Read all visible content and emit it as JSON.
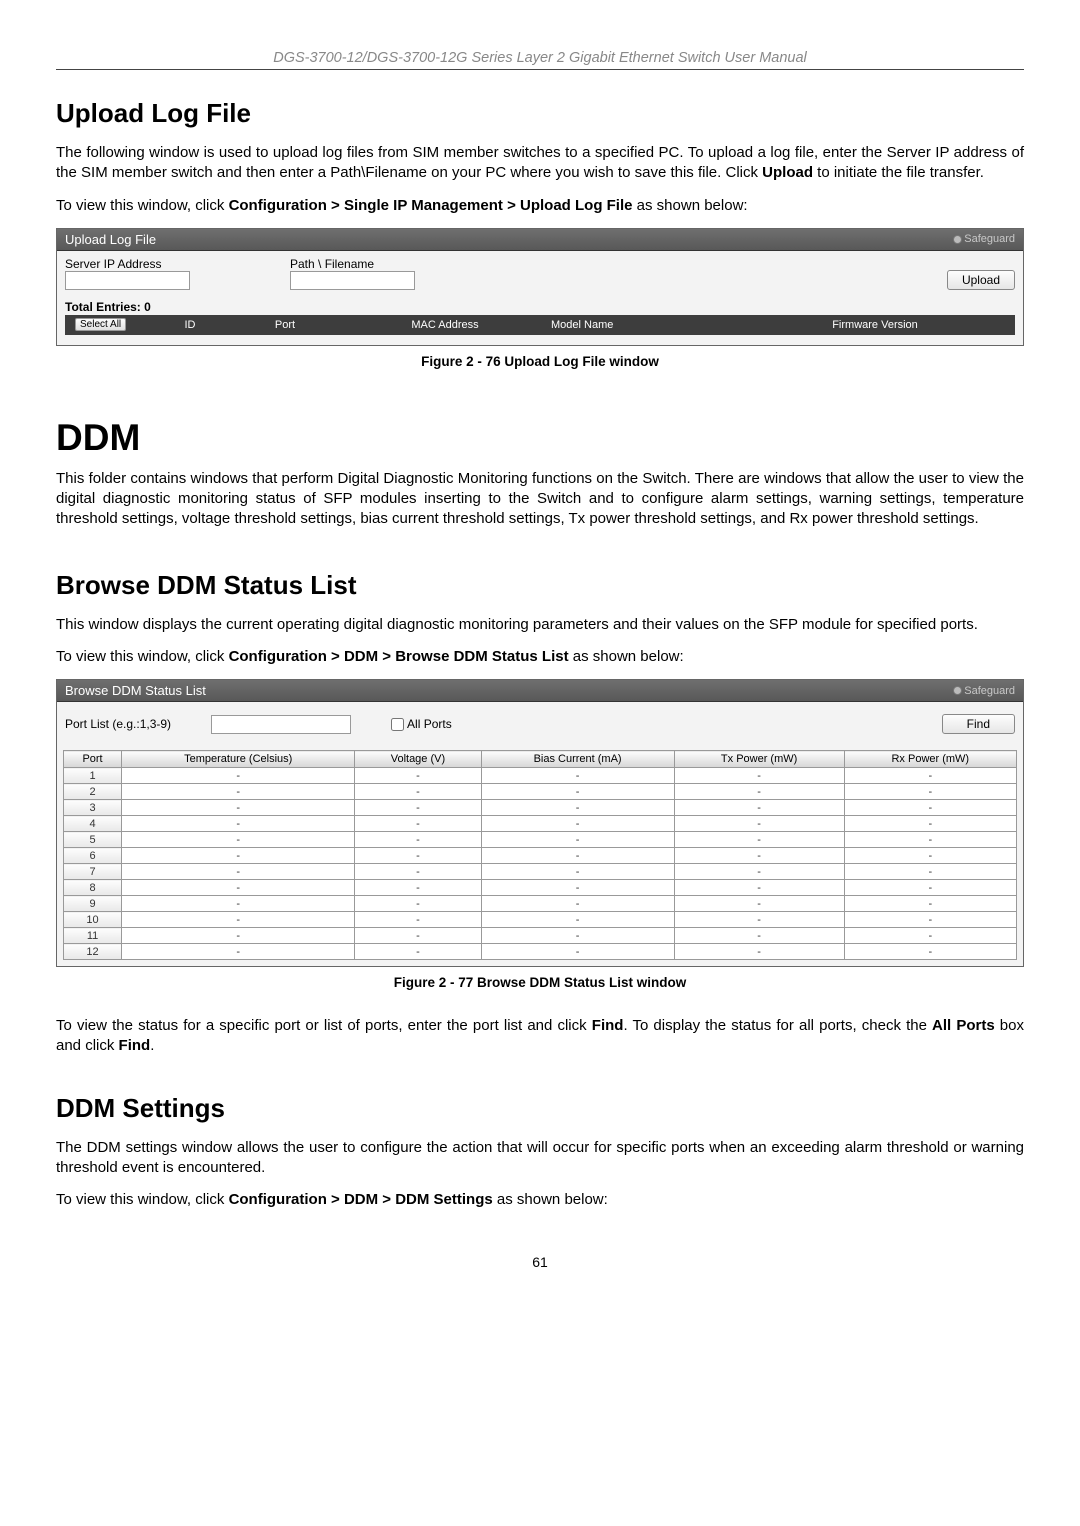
{
  "header_text": "DGS-3700-12/DGS-3700-12G Series Layer 2 Gigabit Ethernet Switch User Manual",
  "page_number": "61",
  "section_upload": {
    "title": "Upload Log File",
    "para1_pre": "The following window is used to upload log files from SIM member switches to a specified PC. To upload a log file, enter the Server IP address of the SIM member switch and then enter a Path\\Filename on your PC where you wish to save this file. Click ",
    "para1_bold": "Upload",
    "para1_post": " to initiate the file transfer.",
    "nav_pre": "To view this window, click ",
    "nav_bold": "Configuration > Single IP Management > Upload Log File",
    "nav_post": " as shown below:"
  },
  "fig_upload": {
    "panel_title": "Upload Log File",
    "safeguard": "Safeguard",
    "server_ip_label": "Server IP Address",
    "path_label": "Path \\ Filename",
    "upload_btn": "Upload",
    "total_entries": "Total Entries: 0",
    "select_all": "Select All",
    "cols": {
      "id": "ID",
      "port": "Port",
      "mac": "MAC Address",
      "model": "Model Name",
      "fw": "Firmware Version"
    },
    "caption": "Figure 2 - 76 Upload Log File window"
  },
  "section_ddm": {
    "title": "DDM",
    "para": "This folder contains windows that perform Digital Diagnostic Monitoring functions on the Switch. There are windows that allow the user to view the digital diagnostic monitoring status of SFP modules inserting to the Switch and to configure alarm settings, warning settings, temperature threshold settings, voltage threshold settings, bias current threshold settings, Tx power threshold settings, and Rx power threshold settings."
  },
  "section_browse": {
    "title": "Browse DDM Status List",
    "para": "This window displays the current operating digital diagnostic monitoring parameters and their values on the SFP module for specified ports.",
    "nav_pre": "To view this window, click ",
    "nav_bold": "Configuration > DDM > Browse DDM Status List",
    "nav_post": " as shown below:"
  },
  "fig_browse": {
    "panel_title": "Browse DDM Status List",
    "safeguard": "Safeguard",
    "portlist_label": "Port List (e.g.:1,3-9)",
    "allports_label": "All Ports",
    "find_btn": "Find",
    "headers": [
      "Port",
      "Temperature (Celsius)",
      "Voltage (V)",
      "Bias Current (mA)",
      "Tx Power (mW)",
      "Rx Power (mW)"
    ],
    "caption": "Figure 2 - 77 Browse DDM Status List window"
  },
  "chart_data": {
    "type": "table",
    "headers": [
      "Port",
      "Temperature (Celsius)",
      "Voltage (V)",
      "Bias Current (mA)",
      "Tx Power (mW)",
      "Rx Power (mW)"
    ],
    "rows": [
      [
        "1",
        "-",
        "-",
        "-",
        "-",
        "-"
      ],
      [
        "2",
        "-",
        "-",
        "-",
        "-",
        "-"
      ],
      [
        "3",
        "-",
        "-",
        "-",
        "-",
        "-"
      ],
      [
        "4",
        "-",
        "-",
        "-",
        "-",
        "-"
      ],
      [
        "5",
        "-",
        "-",
        "-",
        "-",
        "-"
      ],
      [
        "6",
        "-",
        "-",
        "-",
        "-",
        "-"
      ],
      [
        "7",
        "-",
        "-",
        "-",
        "-",
        "-"
      ],
      [
        "8",
        "-",
        "-",
        "-",
        "-",
        "-"
      ],
      [
        "9",
        "-",
        "-",
        "-",
        "-",
        "-"
      ],
      [
        "10",
        "-",
        "-",
        "-",
        "-",
        "-"
      ],
      [
        "11",
        "-",
        "-",
        "-",
        "-",
        "-"
      ],
      [
        "12",
        "-",
        "-",
        "-",
        "-",
        "-"
      ]
    ]
  },
  "after_browse": {
    "p1": "To view the status for a specific port or list of ports, enter the port list and click ",
    "p2": "Find",
    "p3": ". To display the status for all ports, check the ",
    "p4": "All Ports",
    "p5": " box and click ",
    "p6": "Find",
    "p7": "."
  },
  "section_ddm_settings": {
    "title": "DDM Settings",
    "para": "The DDM settings window allows the user to configure the action that will occur for specific ports when an exceeding alarm threshold or warning threshold event is encountered.",
    "nav_pre": "To view this window, click ",
    "nav_bold": "Configuration > DDM > DDM Settings",
    "nav_post": " as shown below:"
  }
}
